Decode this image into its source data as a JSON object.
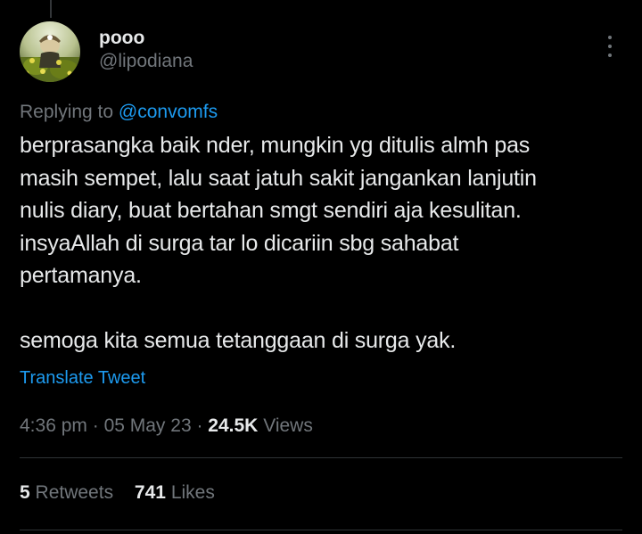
{
  "tweet": {
    "author": {
      "display_name": "pooo",
      "handle": "@lipodiana"
    },
    "replying_to": {
      "prefix": "Replying to",
      "mention": "@convomfs"
    },
    "text_lines": [
      "berprasangka baik nder, mungkin yg ditulis almh pas",
      "masih sempet, lalu saat jatuh sakit jangankan lanjutin",
      "nulis diary, buat bertahan smgt sendiri aja kesulitan.",
      "insyaAllah di surga tar lo dicariin sbg sahabat",
      "pertamanya."
    ],
    "text_last_paragraph": "semoga kita semua tetanggaan di surga yak.",
    "translate_label": "Translate Tweet",
    "meta": {
      "time": "4:36 pm",
      "separator": " · ",
      "date": "05 May 23",
      "views_count": "24.5K",
      "views_label": "Views"
    },
    "stats": {
      "retweets_count": "5",
      "retweets_label": "Retweets",
      "likes_count": "741",
      "likes_label": "Likes"
    }
  },
  "icons": {
    "more": "more-vertical-icon"
  },
  "colors": {
    "background": "#000000",
    "text_primary": "#e7e9ea",
    "text_secondary": "#71767b",
    "accent": "#1d9bf0",
    "divider": "#2f3336"
  }
}
